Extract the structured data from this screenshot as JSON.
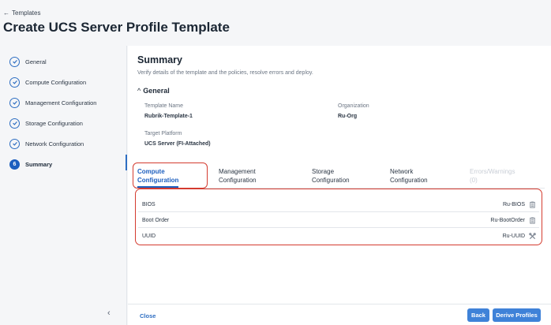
{
  "header": {
    "back_label": "Templates",
    "back_arrow": "←",
    "title": "Create UCS Server Profile Template"
  },
  "steps": [
    {
      "label": "General",
      "status": "done"
    },
    {
      "label": "Compute Configuration",
      "status": "done"
    },
    {
      "label": "Management Configuration",
      "status": "done"
    },
    {
      "label": "Storage Configuration",
      "status": "done"
    },
    {
      "label": "Network Configuration",
      "status": "done"
    },
    {
      "label": "Summary",
      "status": "active",
      "number": "6"
    }
  ],
  "sidebar": {
    "collapse_glyph": "‹"
  },
  "summary": {
    "title": "Summary",
    "subtitle": "Verify details of the template and the policies, resolve errors and deploy.",
    "general_section": {
      "chevron": "^",
      "title": "General",
      "template_name_label": "Template Name",
      "template_name_value": "Rubrik-Template-1",
      "organization_label": "Organization",
      "organization_value": "Ru-Org",
      "target_platform_label": "Target Platform",
      "target_platform_value": "UCS Server (FI-Attached)"
    }
  },
  "tabs": [
    {
      "line1": "Compute",
      "line2": "Configuration",
      "state": "active"
    },
    {
      "line1": "Management",
      "line2": "Configuration",
      "state": "normal"
    },
    {
      "line1": "Storage",
      "line2": "Configuration",
      "state": "normal"
    },
    {
      "line1": "Network",
      "line2": "Configuration",
      "state": "normal"
    },
    {
      "line1": "Errors/Warnings",
      "line2": "(0)",
      "state": "disabled"
    }
  ],
  "policies": [
    {
      "name": "BIOS",
      "value": "Ru-BIOS",
      "icon": "clipboard-icon"
    },
    {
      "name": "Boot Order",
      "value": "Ru-BootOrder",
      "icon": "clipboard-icon"
    },
    {
      "name": "UUID",
      "value": "Ru-UUID",
      "icon": "tools-icon"
    }
  ],
  "footer": {
    "close_label": "Close",
    "back_label": "Back",
    "derive_label": "Derive Profiles"
  },
  "colors": {
    "accent": "#1d5fbf",
    "button": "#3f82d8",
    "annotation_red": "#d43b2f"
  }
}
